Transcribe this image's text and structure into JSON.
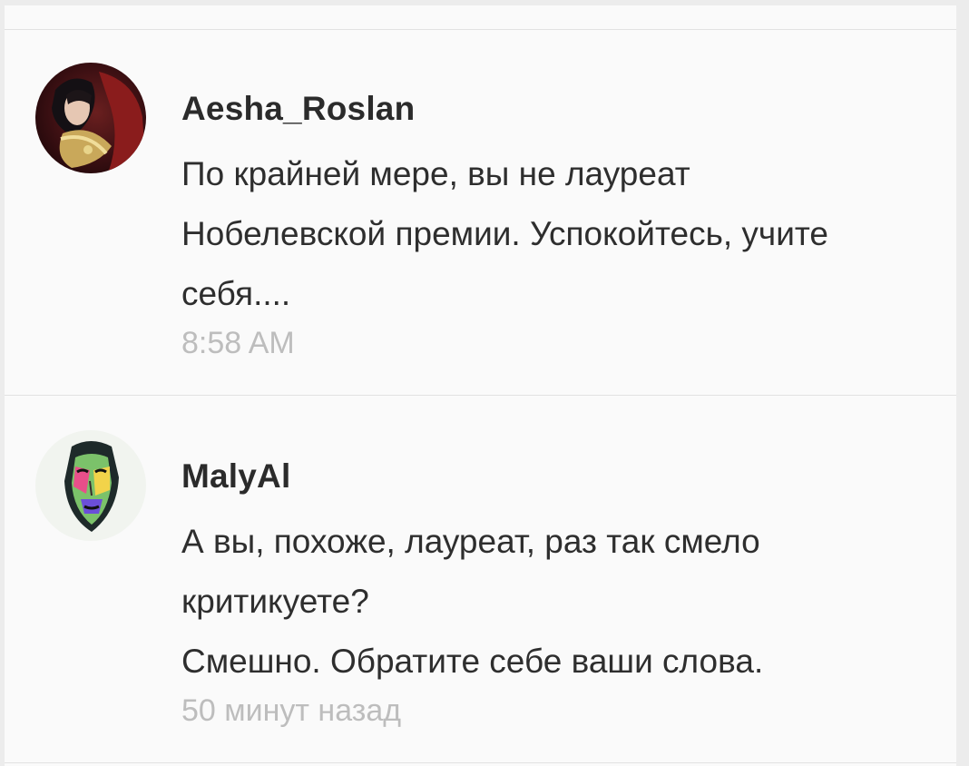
{
  "comments": [
    {
      "author": "Aesha_Roslan",
      "lines": [
        "По крайней мере, вы не лауреат",
        "Нобелевской премии. Успокойтесь, учите",
        "себя...."
      ],
      "time": "8:58 AM"
    },
    {
      "author": "MalyAl",
      "lines": [
        "А вы, похоже, лауреат, раз так смело",
        "критикуете?",
        "Смешно. Обратите себе ваши слова."
      ],
      "time": "50 минут назад"
    }
  ],
  "colors": {
    "background": "#fafafa",
    "author": "#2b2b2b",
    "text": "#2e2e2e",
    "timestamp": "#bdbdbd",
    "divider": "#e2e2e2"
  }
}
